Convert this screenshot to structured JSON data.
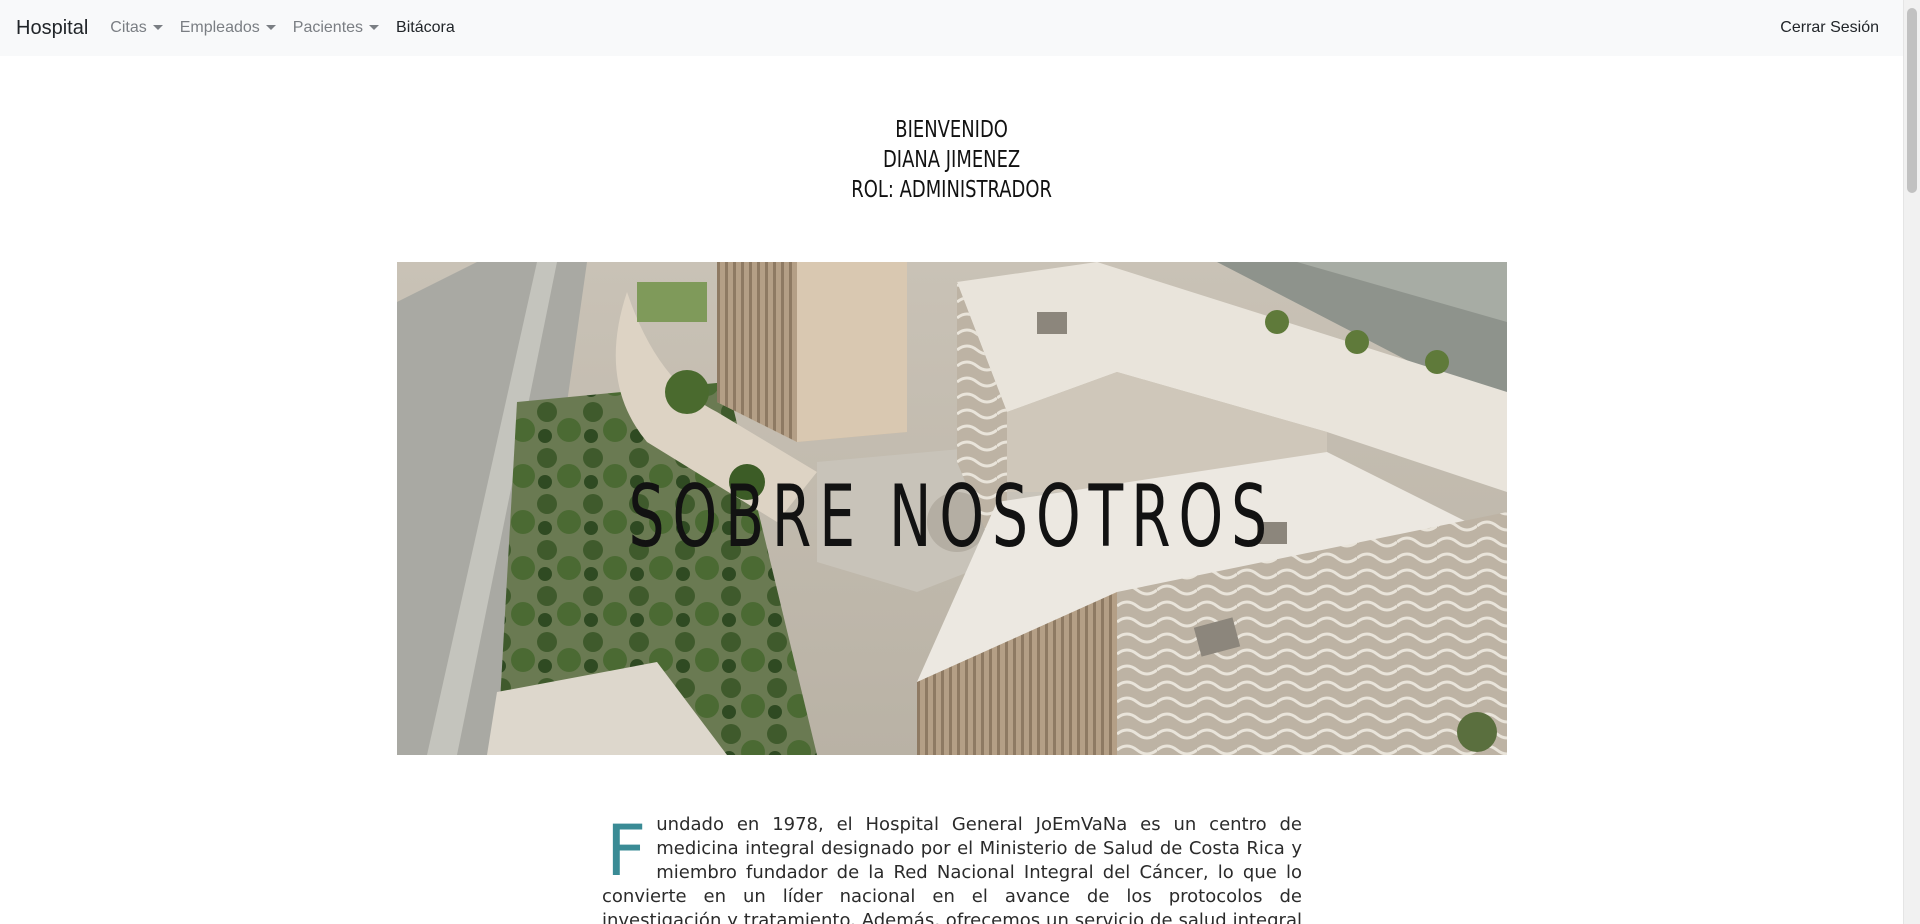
{
  "navbar": {
    "brand": "Hospital",
    "menus": [
      {
        "label": "Citas"
      },
      {
        "label": "Empleados"
      },
      {
        "label": "Pacientes"
      }
    ],
    "bitacora": "Bitácora",
    "logout": "Cerrar Sesión"
  },
  "welcome": {
    "line1": "BIENVENIDO",
    "line2": "DIANA JIMENEZ",
    "line3": "ROL: ADMINISTRADOR"
  },
  "hero": {
    "title": "SOBRE NOSOTROS"
  },
  "about": {
    "dropcap": "F",
    "text": "undado en 1978, el Hospital General JoEmVaNa es un centro de medicina integral designado por el Ministerio de Salud de Costa Rica y miembro fundador de la Red Nacional Integral del Cáncer, lo que lo convierte en un líder nacional en el avance de los protocolos de investigación y tratamiento. Además, ofrecemos un servicio de salud integral a los sectores más vulnerables de"
  },
  "colors": {
    "navbar_bg": "#f8f9fa",
    "dropcap": "#3a8b95"
  }
}
